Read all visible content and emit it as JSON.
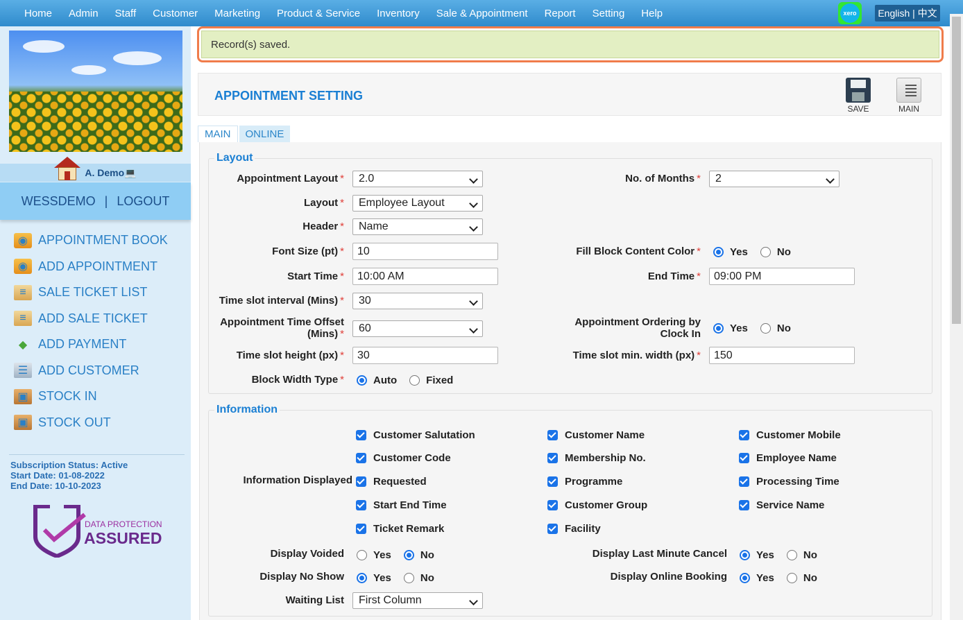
{
  "nav": {
    "items": [
      "Home",
      "Admin",
      "Staff",
      "Customer",
      "Marketing",
      "Product & Service",
      "Inventory",
      "Sale & Appointment",
      "Report",
      "Setting",
      "Help"
    ],
    "xero": "xero",
    "language": "English | 中文"
  },
  "sidebar": {
    "username": "A. Demo💻",
    "account": "WESSDEMO",
    "separator": "|",
    "logout": "LOGOUT",
    "links": [
      {
        "label": "APPOINTMENT BOOK",
        "icon": "calendar-icon"
      },
      {
        "label": "ADD APPOINTMENT",
        "icon": "calendar-add-icon"
      },
      {
        "label": "SALE TICKET LIST",
        "icon": "ticket-icon"
      },
      {
        "label": "ADD SALE TICKET",
        "icon": "ticket-add-icon"
      },
      {
        "label": "ADD PAYMENT",
        "icon": "payment-icon"
      },
      {
        "label": "ADD CUSTOMER",
        "icon": "customer-icon"
      },
      {
        "label": "STOCK IN",
        "icon": "stock-in-icon"
      },
      {
        "label": "STOCK OUT",
        "icon": "stock-out-icon"
      }
    ],
    "subscription": {
      "status": "Subscription Status: Active",
      "start": "Start Date: 01-08-2022",
      "end": "End Date: 10-10-2023"
    },
    "badge": {
      "line1": "DATA PROTECTION",
      "line2": "ASSURED"
    }
  },
  "alert": "Record(s) saved.",
  "page": {
    "title": "APPOINTMENT SETTING",
    "save": "SAVE",
    "main": "MAIN"
  },
  "tabs": [
    "MAIN",
    "ONLINE"
  ],
  "layout": {
    "legend": "Layout",
    "appointment_layout": {
      "label": "Appointment Layout",
      "value": "2.0"
    },
    "months": {
      "label": "No. of Months",
      "value": "2"
    },
    "layout": {
      "label": "Layout",
      "value": "Employee Layout"
    },
    "header": {
      "label": "Header",
      "value": "Name"
    },
    "font_size": {
      "label": "Font Size (pt)",
      "value": "10"
    },
    "fill_block": {
      "label": "Fill Block Content Color",
      "yes": "Yes",
      "no": "No"
    },
    "start_time": {
      "label": "Start Time",
      "value": "10:00 AM"
    },
    "end_time": {
      "label": "End Time",
      "value": "09:00 PM"
    },
    "slot_interval": {
      "label": "Time slot interval (Mins)",
      "value": "30"
    },
    "time_offset": {
      "label1": "Appointment Time Offset",
      "label2": "(Mins)",
      "value": "60"
    },
    "ordering": {
      "label1": "Appointment Ordering by",
      "label2": "Clock In",
      "yes": "Yes",
      "no": "No"
    },
    "slot_height": {
      "label": "Time slot height (px)",
      "value": "30"
    },
    "slot_width": {
      "label": "Time slot min. width (px)",
      "value": "150"
    },
    "block_width": {
      "label": "Block Width Type",
      "auto": "Auto",
      "fixed": "Fixed"
    }
  },
  "information": {
    "legend": "Information",
    "displayed_label": "Information Displayed",
    "checks": [
      "Customer Salutation",
      "Customer Name",
      "Customer Mobile",
      "Customer Code",
      "Membership No.",
      "Employee Name",
      "Requested",
      "Programme",
      "Processing Time",
      "Start End Time",
      "Customer Group",
      "Service Name",
      "Ticket Remark",
      "Facility"
    ],
    "voided": {
      "label": "Display Voided",
      "yes": "Yes",
      "no": "No"
    },
    "last_minute": {
      "label": "Display Last Minute Cancel",
      "yes": "Yes",
      "no": "No"
    },
    "no_show": {
      "label": "Display No Show",
      "yes": "Yes",
      "no": "No"
    },
    "online_booking": {
      "label": "Display Online Booking",
      "yes": "Yes",
      "no": "No"
    },
    "waiting_list": {
      "label": "Waiting List",
      "value": "First Column"
    }
  }
}
